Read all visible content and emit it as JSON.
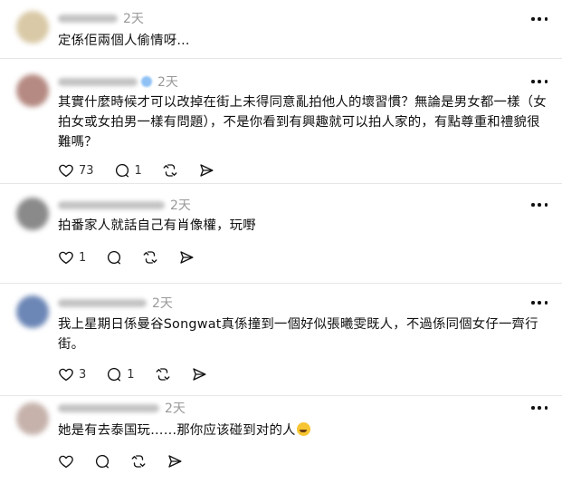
{
  "comments": [
    {
      "time": "2天",
      "text": "定係佢兩個人偷情呀...",
      "likes": "",
      "replies": ""
    },
    {
      "time": "2天",
      "text": "其實什麼時候才可以改掉在街上未得同意亂拍他人的壞習慣？無論是男女都一樣（女拍女或女拍男一樣有問題），不是你看到有興趣就可以拍人家的，有點尊重和禮貌很難嗎？",
      "likes": "73",
      "replies": "1"
    },
    {
      "time": "2天",
      "text": "拍番家人就話自己有肖像權，玩嘢",
      "likes": "1",
      "replies": ""
    },
    {
      "time": "2天",
      "text": "我上星期日係曼谷Songwat真係撞到一個好似張曦雯既人，不過係同個女仔一齊行街。",
      "likes": "3",
      "replies": "1"
    },
    {
      "time": "2天",
      "text": "她是有去泰国玩……那你应该碰到对的人",
      "likes": "",
      "replies": ""
    }
  ],
  "icons": {
    "like": "heart-icon",
    "reply": "comment-icon",
    "repost": "repost-icon",
    "share": "send-icon",
    "more": "more-options-icon",
    "emoji": "rofl-emoji"
  },
  "colors": {
    "text": "#101010",
    "muted": "#999999",
    "divider": "#e6e6e6",
    "verified": "#8fc1f5"
  }
}
